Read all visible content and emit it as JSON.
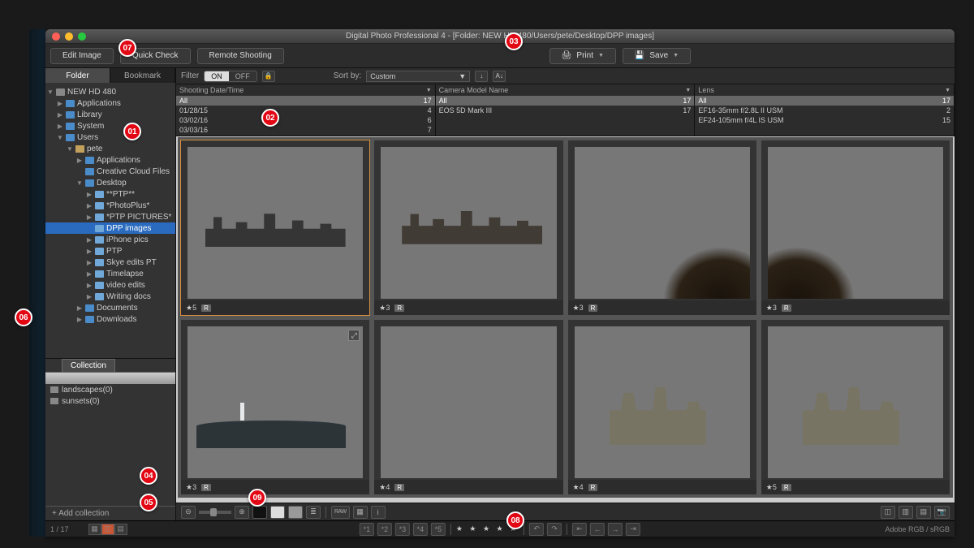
{
  "app_title": "Digital Photo Professional 4 - [Folder: NEW HD 480/Users/pete/Desktop/DPP images]",
  "toolbar": {
    "edit_image": "Edit Image",
    "quick_check": "Quick Check",
    "remote_shooting": "Remote Shooting",
    "print": "Print",
    "save": "Save"
  },
  "sidebar_tabs": {
    "folder": "Folder",
    "bookmark": "Bookmark"
  },
  "tree": {
    "root": "NEW HD 480",
    "lvl1": [
      "Applications",
      "Library",
      "System",
      "Users"
    ],
    "user": "pete",
    "userlvl": [
      "Applications",
      "Creative Cloud Files",
      "Desktop"
    ],
    "desktop": [
      "**PTP**",
      "*PhotoPlus*",
      "*PTP PICTURES*",
      "DPP images",
      "iPhone pics",
      "PTP",
      "Skye edits PT",
      "Timelapse",
      "video edits",
      "Writing docs"
    ],
    "after": [
      "Documents",
      "Downloads"
    ]
  },
  "collection": {
    "tab": "Collection",
    "items": [
      "landscapes(0)",
      "sunsets(0)"
    ],
    "add": "+  Add collection"
  },
  "filter": {
    "label": "Filter",
    "on": "ON",
    "off": "OFF",
    "sort_label": "Sort by:",
    "sort_value": "Custom"
  },
  "meta_headers": [
    "Shooting Date/Time",
    "Camera Model Name",
    "Lens"
  ],
  "meta_col1": [
    {
      "k": "All",
      "v": "17",
      "all": true
    },
    {
      "k": "01/28/15",
      "v": "4"
    },
    {
      "k": "03/02/16",
      "v": "6"
    },
    {
      "k": "03/03/16",
      "v": "7"
    }
  ],
  "meta_col2": [
    {
      "k": "All",
      "v": "17",
      "all": true
    },
    {
      "k": "EOS 5D Mark III",
      "v": "17"
    }
  ],
  "meta_col3": [
    {
      "k": "All",
      "v": "17",
      "all": true
    },
    {
      "k": "EF16-35mm f/2.8L II USM",
      "v": "2"
    },
    {
      "k": "EF24-105mm f/4L IS USM",
      "v": "15"
    }
  ],
  "thumbs": [
    {
      "rating": "★5",
      "badge": "R",
      "sel": true,
      "scene": "sky-cloudy",
      "castle": true
    },
    {
      "rating": "★3",
      "badge": "R",
      "scene": "sky-warm",
      "castle": true,
      "warm": true
    },
    {
      "rating": "★3",
      "badge": "R",
      "scene": "beach",
      "rocks": true
    },
    {
      "rating": "★3",
      "badge": "R",
      "scene": "beach2",
      "rocks2": true
    },
    {
      "rating": "★3",
      "badge": "R",
      "scene": "light1",
      "pier": true,
      "expand": true
    },
    {
      "rating": "★4",
      "badge": "R",
      "scene": "sunset"
    },
    {
      "rating": "★4",
      "badge": "R",
      "scene": "ruins",
      "ruin": true
    },
    {
      "rating": "★5",
      "badge": "R",
      "scene": "ruins-warm",
      "ruin": true
    }
  ],
  "status": {
    "count": "1 / 17",
    "colorspace": "Adobe RGB / sRGB"
  },
  "checkmarks": [
    "*1",
    "*2",
    "*3",
    "*4",
    "*5"
  ],
  "stars": "★ ★ ★ ★ ★",
  "callouts": {
    "01": "01",
    "02": "02",
    "03": "03",
    "04": "04",
    "05": "05",
    "06": "06",
    "07": "07",
    "08": "08",
    "09": "09"
  },
  "raw_label": "RAW"
}
